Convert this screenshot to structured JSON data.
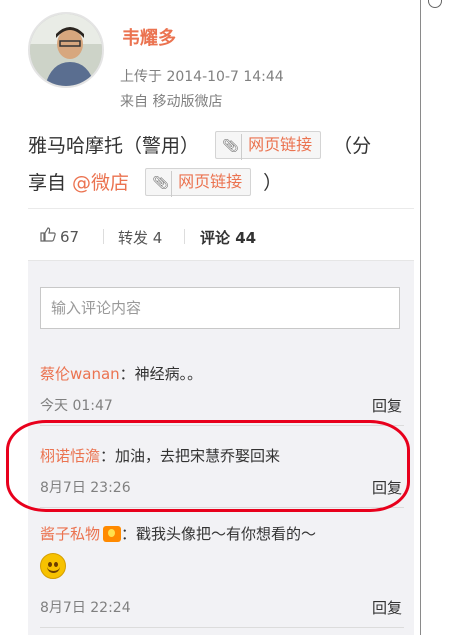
{
  "post": {
    "author": "韦耀多",
    "uploaded": "上传于 2014-10-7 14:44",
    "source": "来自 移动版微店",
    "text_line1": "雅马哈摩托（警用）",
    "link_label": "网页链接",
    "text_line1_suffix": "（分",
    "text_line2_prefix": "享自 ",
    "mention": "@微店",
    "text_line2_suffix": "）"
  },
  "actions": {
    "likes": "67",
    "repost": "转发 4",
    "comment": "评论 44"
  },
  "comments_section": {
    "input_placeholder": "输入评论内容",
    "reply_label": "回复",
    "items": [
      {
        "name": "蔡伦wanan",
        "text": "：神经病。。",
        "time": "今天 01:47"
      },
      {
        "name": "栩诺恬澹",
        "text": "：加油，去把宋慧乔娶回来",
        "time": "8月7日 23:26"
      },
      {
        "name": "酱子私物",
        "text": "：戳我头像把～有你想看的～",
        "time": "8月7日 22:24"
      }
    ]
  },
  "colors": {
    "accent": "#eb7350",
    "highlight": "#e8001c",
    "comment_bg": "#f2f2f5"
  }
}
